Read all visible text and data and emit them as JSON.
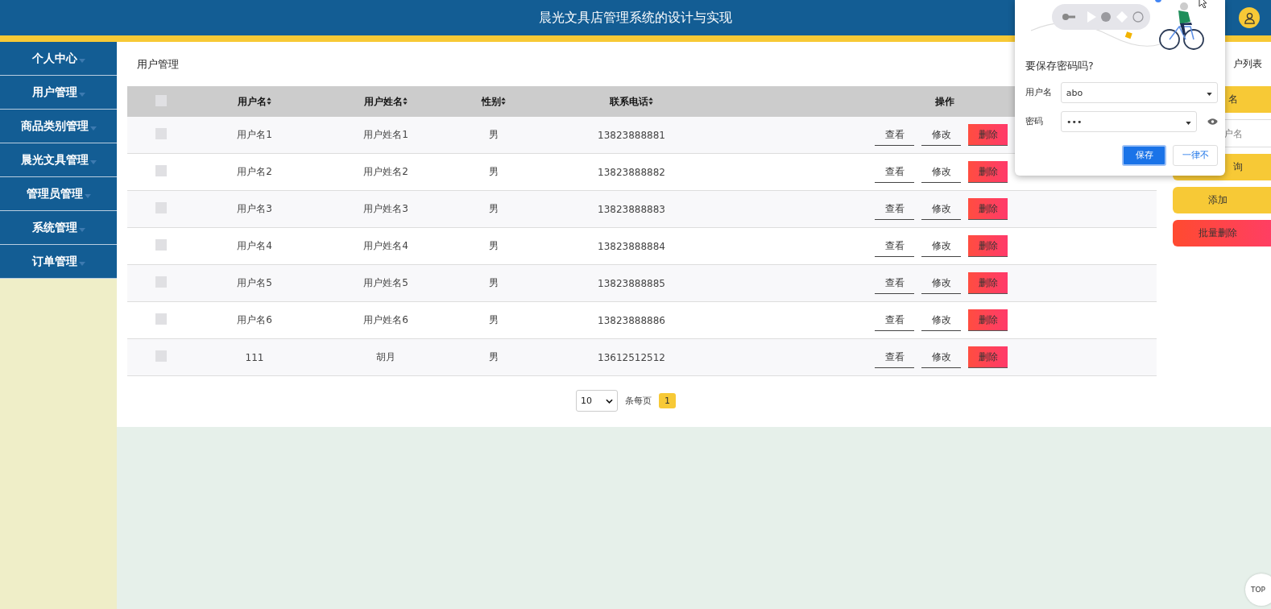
{
  "header": {
    "title": "晨光文具店管理系统的设计与实现"
  },
  "sidebar": {
    "items": [
      {
        "label": "个人中心"
      },
      {
        "label": "用户管理"
      },
      {
        "label": "商品类别管理"
      },
      {
        "label": "晨光文具管理"
      },
      {
        "label": "管理员管理"
      },
      {
        "label": "系统管理"
      },
      {
        "label": "订单管理"
      }
    ]
  },
  "page_title": "用户管理",
  "table": {
    "select_all_checked": false,
    "columns": [
      {
        "label": "用户名",
        "sortable": true
      },
      {
        "label": "用户姓名",
        "sortable": true
      },
      {
        "label": "性别",
        "sortable": true
      },
      {
        "label": "联系电话",
        "sortable": true
      },
      {
        "label": "操作",
        "sortable": false
      }
    ],
    "rows": [
      {
        "checked": false,
        "cells": [
          "用户名1",
          "用户姓名1",
          "男",
          "13823888881"
        ],
        "actions": [
          {
            "label": "查看",
            "kind": "plain"
          },
          {
            "label": "修改",
            "kind": "plain"
          },
          {
            "label": "删除",
            "kind": "danger"
          }
        ]
      },
      {
        "checked": false,
        "cells": [
          "用户名2",
          "用户姓名2",
          "男",
          "13823888882"
        ],
        "actions": [
          {
            "label": "查看",
            "kind": "plain"
          },
          {
            "label": "修改",
            "kind": "plain"
          },
          {
            "label": "删除",
            "kind": "danger"
          }
        ]
      },
      {
        "checked": false,
        "cells": [
          "用户名3",
          "用户姓名3",
          "男",
          "13823888883"
        ],
        "actions": [
          {
            "label": "查看",
            "kind": "plain"
          },
          {
            "label": "修改",
            "kind": "plain"
          },
          {
            "label": "删除",
            "kind": "danger"
          }
        ]
      },
      {
        "checked": false,
        "cells": [
          "用户名4",
          "用户姓名4",
          "男",
          "13823888884"
        ],
        "actions": [
          {
            "label": "查看",
            "kind": "plain"
          },
          {
            "label": "修改",
            "kind": "plain"
          },
          {
            "label": "删除",
            "kind": "danger"
          }
        ]
      },
      {
        "checked": false,
        "cells": [
          "用户名5",
          "用户姓名5",
          "男",
          "13823888885"
        ],
        "actions": [
          {
            "label": "查看",
            "kind": "plain"
          },
          {
            "label": "修改",
            "kind": "plain"
          },
          {
            "label": "删除",
            "kind": "danger"
          }
        ]
      },
      {
        "checked": false,
        "cells": [
          "用户名6",
          "用户姓名6",
          "男",
          "13823888886"
        ],
        "actions": [
          {
            "label": "查看",
            "kind": "plain"
          },
          {
            "label": "修改",
            "kind": "plain"
          },
          {
            "label": "删除",
            "kind": "danger"
          }
        ]
      },
      {
        "checked": false,
        "cells": [
          "111",
          "胡月",
          "男",
          "13612512512"
        ],
        "actions": [
          {
            "label": "查看",
            "kind": "plain"
          },
          {
            "label": "修改",
            "kind": "plain"
          },
          {
            "label": "删除",
            "kind": "danger"
          }
        ]
      }
    ]
  },
  "pagination": {
    "page_size": "10",
    "page_size_label": "条每页",
    "pages": [
      {
        "label": "1",
        "selected": true
      }
    ]
  },
  "right_panel": {
    "title": "户列表",
    "search_button": "名",
    "search_placeholder": "户名",
    "query_button": "询",
    "add_button": "添加",
    "batch_delete_button": "批量删除"
  },
  "save_password_popup": {
    "question": "要保存密码吗?",
    "username_label": "用户名",
    "username": "abo",
    "password_label": "密码",
    "password": "•••",
    "save_button": "保存",
    "never_button": "一律不"
  },
  "back_to_top": "TOP"
}
